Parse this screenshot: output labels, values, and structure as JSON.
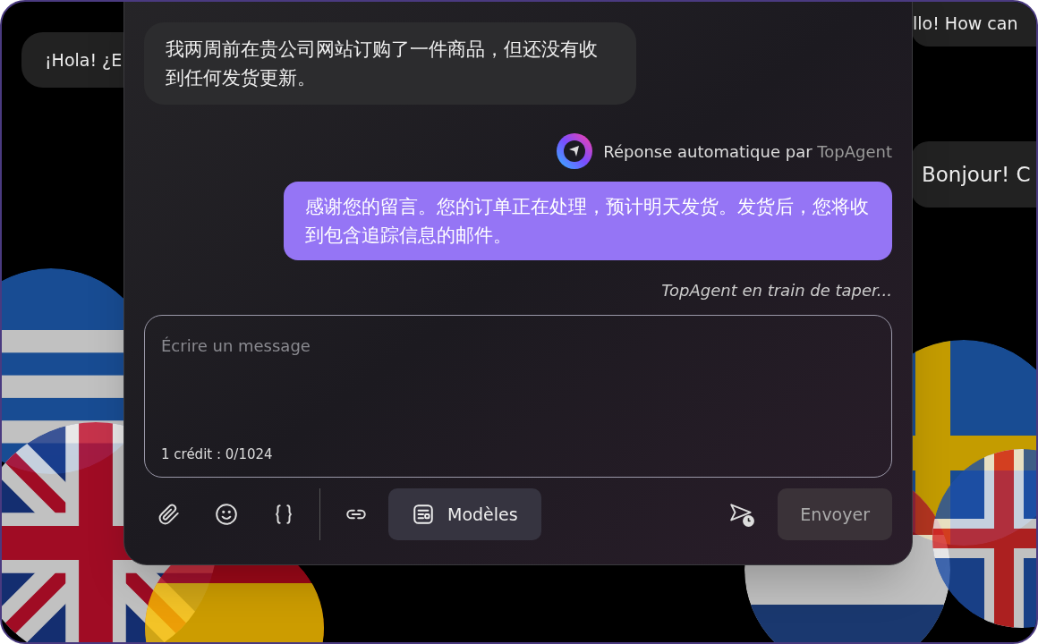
{
  "background_bubbles": [
    {
      "text": "¡Hola! ¿E"
    },
    {
      "text": "llo! How can"
    },
    {
      "text": "Bonjour! C"
    }
  ],
  "conversation": {
    "customer_message": "我两周前在贵公司网站订购了一件商品，但还没有收到任何发货更新。",
    "auto_reply_label": "Réponse automatique par",
    "agent_name": "TopAgent",
    "agent_message": "感谢您的留言。您的订单正在处理，预计明天发货。发货后，您将收到包含追踪信息的邮件。",
    "typing_indicator": "TopAgent en train de taper..."
  },
  "composer": {
    "placeholder": "Écrire un message",
    "credit_counter": "1 crédit : 0/1024"
  },
  "toolbar": {
    "templates_button": "Modèles",
    "send_button": "Envoyer",
    "send_disabled": true
  }
}
